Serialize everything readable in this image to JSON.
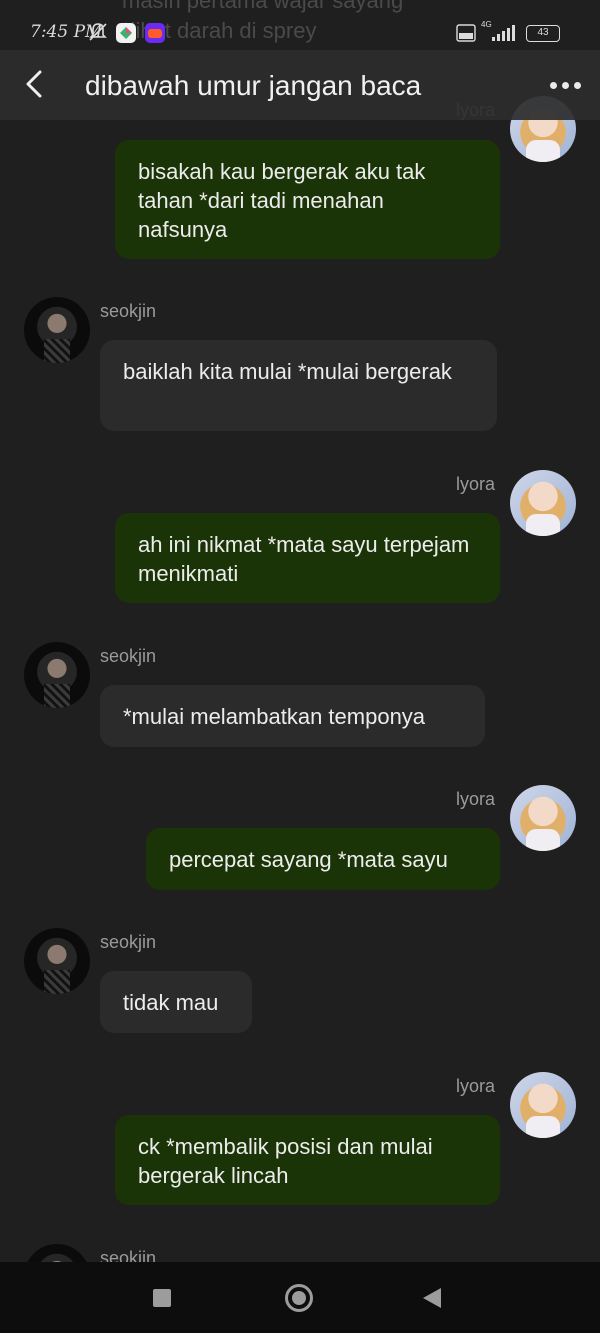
{
  "status_bar": {
    "time": "7:45 PM",
    "icons": [
      "mute-bell-icon",
      "app-icon-1",
      "app-icon-2",
      "volte-icon",
      "signal-icon",
      "battery-icon"
    ],
    "network": "4G",
    "volte": "Vo LTE",
    "battery": "43"
  },
  "header": {
    "title": "dibawah umur jangan baca"
  },
  "previous_message_fragment": "masih pertama wajar sayang *lihat darah di sprey",
  "messages": [
    {
      "sender": "lyora",
      "text": "bisakah kau bergerak aku tak tahan *dari tadi menahan nafsunya"
    },
    {
      "sender": "seokjin",
      "text": "baiklah kita mulai *mulai bergerak"
    },
    {
      "sender": "lyora",
      "text": "ah ini nikmat *mata sayu terpejam menikmati"
    },
    {
      "sender": "seokjin",
      "text": "*mulai melambatkan temponya"
    },
    {
      "sender": "lyora",
      "text": "percepat sayang *mata sayu"
    },
    {
      "sender": "seokjin",
      "text": "tidak mau"
    },
    {
      "sender": "lyora",
      "text": "ck *membalik posisi dan mulai bergerak lincah"
    },
    {
      "sender": "seokjin",
      "text": ""
    }
  ],
  "colors": {
    "background": "#1f1f1f",
    "my_bubble": "#1b3407",
    "their_bubble": "#2b2b2b",
    "header": "#2c2c2c"
  }
}
